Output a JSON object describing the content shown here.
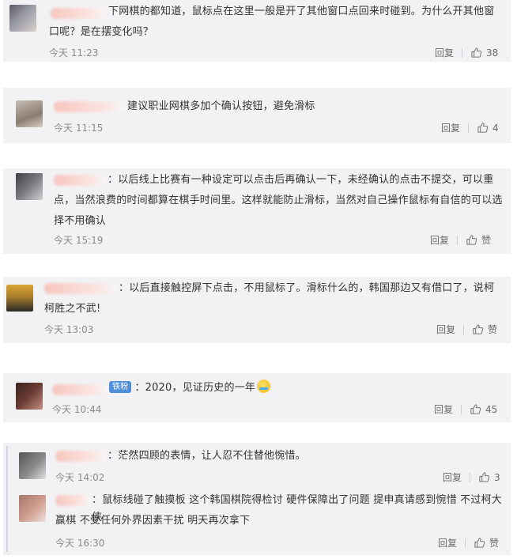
{
  "comments": [
    {
      "text": "下网棋的都知道，鼠标点在这里一般是开了其他窗口点回来时碰到。为什么开其他窗口呢？是在摆变化吗？",
      "line1": "下网棋的都知道，鼠标点在这里一般是开了其他窗口点回来时碰到。为什么开其他窗",
      "line2": "口呢？是在摆变化吗？",
      "time": "今天 11:23",
      "reply_label": "回复",
      "likes": "38"
    },
    {
      "text": "建议职业网棋多加个确认按钮，避免滑标",
      "time": "今天 11:15",
      "reply_label": "回复",
      "likes": "4"
    },
    {
      "line1": "：以后线上比赛有一种设定可以点击后再确认一下，未经确认的点击不提交，可以重",
      "line2": "点，当然浪费的时间都算在棋手时间里。这样就能防止滑标，当然对自己操作鼠标有自信的可以选",
      "line3": "择不用确认",
      "time": "今天 15:19",
      "reply_label": "回复",
      "likes": "赞"
    },
    {
      "line1": "：以后直接触控屏下点击，不用鼠标了。滑标什么的，韩国那边又有借口了，说柯",
      "line2": "柯胜之不武!",
      "time": "今天 13:03",
      "reply_label": "回复",
      "likes": "赞"
    },
    {
      "badge": "铁粉",
      "text": "：2020，见证历史的一年",
      "time": "今天 10:44",
      "reply_label": "回复",
      "likes": "45"
    }
  ],
  "thread": {
    "main": {
      "text": "：茫然四顾的表情，让人忍不住替他惋惜。",
      "time": "今天 14:02",
      "reply_label": "回复",
      "likes": "3"
    },
    "reply": {
      "line1": "：鼠标线碰了触摸板 这个韩国棋院得检讨 硬件保障出了问题 提申真请感到惋惜 不过柯大侠",
      "line2": "赢棋 不受任何外界因素干扰 明天再次拿下",
      "time": "今天 16:30",
      "reply_label": "回复",
      "likes": "赞"
    }
  },
  "icons": {
    "like": "thumbs-up-icon"
  },
  "colors": {
    "card_bg": "#f2f2f5",
    "badge": "#4e8fdc",
    "time": "#8a8a8a"
  }
}
